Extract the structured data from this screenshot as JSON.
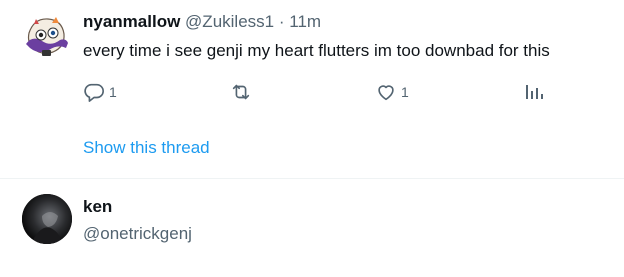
{
  "tweet": {
    "display_name": "nyanmallow",
    "handle": "@Zukiless1",
    "separator": "·",
    "time": "11m",
    "text": "every time i see genji my heart flutters im too downbad for this",
    "actions": {
      "reply_count": "1",
      "retweet_count": "",
      "like_count": "1",
      "views_count": ""
    },
    "show_thread_label": "Show this thread"
  },
  "user_card": {
    "display_name": "ken",
    "handle": "@onetrickgenj"
  },
  "colors": {
    "text": "#0f1419",
    "muted": "#536471",
    "link": "#1d9bf0",
    "divider": "#eff3f4"
  },
  "icons": {
    "reply": "reply-icon",
    "retweet": "retweet-icon",
    "like": "heart-icon",
    "views": "views-chart-icon"
  }
}
